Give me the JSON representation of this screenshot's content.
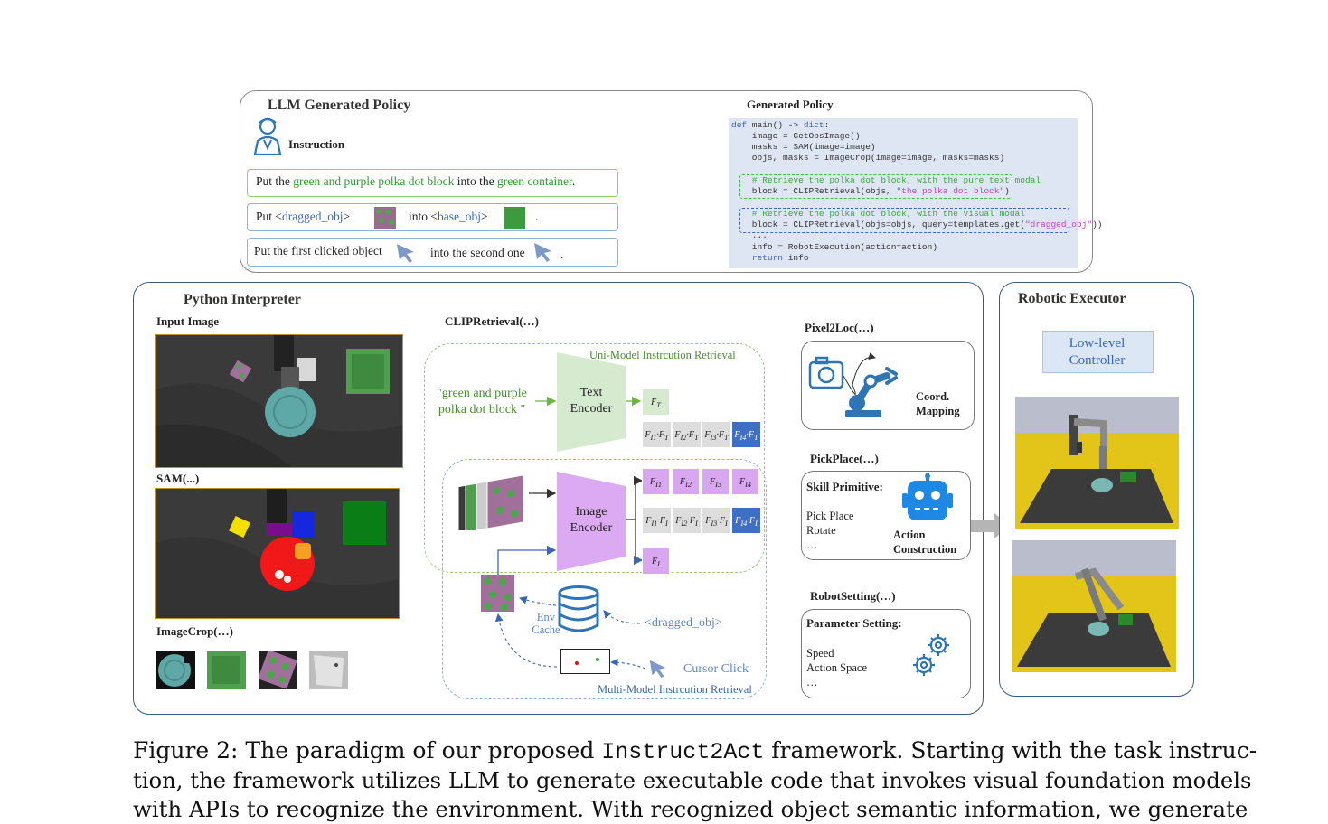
{
  "llm_policy": {
    "title": "LLM Generated Policy",
    "instruction_label": "Instruction",
    "instr1": {
      "p1": "Put the ",
      "p2": "green and purple polka dot block",
      "p3": " into the ",
      "p4": "green container",
      "p5": "."
    },
    "instr2": {
      "p1": "Put  <",
      "p2": "dragged_obj",
      "p3": ">",
      "p4": "into <",
      "p5": "base_obj",
      "p6": ">",
      "p7": "."
    },
    "instr3": {
      "p1": "Put the first clicked object",
      "p2": "into the second one",
      "p3": "."
    },
    "generated_title": "Generated Policy",
    "code": {
      "l1a": "def",
      "l1b": " main() -> ",
      "l1c": "dict",
      "l1d": ":",
      "l2": "    image = GetObsImage()",
      "l3": "    masks = SAM(image=image)",
      "l4": "    objs, masks = ImageCrop(image=image, masks=masks)",
      "l5": "    # Retrieve the polka dot block, with the pure text modal",
      "l6a": "    block = CLIPRetrieval(objs, ",
      "l6b": "\"the polka dot block\"",
      "l6c": ")",
      "l7": "    # Retrieve the polka dot block, with the visual modal",
      "l8a": "    block = CLIPRetrieval(objs=objs, query=templates.get(",
      "l8b": "\"dragged_obj\"",
      "l8c": "))",
      "l9": "    ...",
      "l10": "    info = RobotExecution(action=action)",
      "l11a": "    return",
      "l11b": " info"
    }
  },
  "interpreter": {
    "title": "Python Interpreter",
    "input_image": "Input Image",
    "sam": "SAM(...)",
    "imagecrop": "ImageCrop(…)",
    "clip_title": "CLIPRetrieval(…)",
    "uni_model": "Uni-Model Instrcution Retrieval",
    "multi_model": "Multi-Model Instrcution Retrieval",
    "text_query": "\"green and purple polka dot block \"",
    "text_encoder": "Text Encoder",
    "image_encoder": "Image Encoder",
    "env_cache": "Env Cache",
    "dragged_obj": "<dragged_obj>",
    "cursor_click": "Cursor Click",
    "pixel2loc": "Pixel2Loc(…)",
    "coord_mapping": "Coord. Mapping",
    "pickplace": "PickPlace(…)",
    "skill_primitive": "Skill Primitive:",
    "skills": [
      "Pick Place",
      "Rotate",
      "…"
    ],
    "action_construction": "Action Construction",
    "robotsetting": "RobotSetting(…)",
    "parameter_setting": "Parameter Setting:",
    "params": [
      "Speed",
      "Action Space",
      "…"
    ]
  },
  "executor": {
    "title": "Robotic Executor",
    "controller": "Low-level Controller"
  },
  "caption": {
    "line1a": "Figure 2: The paradigm of our proposed ",
    "line1b": "Instruct2Act",
    "line1c": " framework. Starting with the task instruc-",
    "line2": "tion, the framework utilizes LLM to generate executable code that invokes visual foundation models",
    "line3": "with APIs to recognize the environment. With recognized object semantic information, we generate"
  },
  "colors": {
    "panel_border": "#3d5a80",
    "green_text": "#2f9a2f",
    "blue_text": "#3a68b0",
    "code_bg": "#dfe6f3",
    "purple_cell": "#d9a6f0",
    "blue_cell": "#3f6fc4"
  }
}
